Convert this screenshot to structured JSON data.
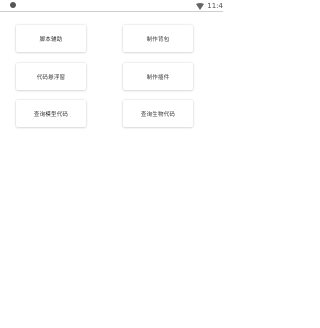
{
  "status_bar": {
    "time": "11:4",
    "left_icon": "status-dot-icon",
    "wifi_icon": "wifi-icon"
  },
  "tiles": [
    {
      "label": "脚本辅助"
    },
    {
      "label": "制作背包"
    },
    {
      "label": "代码悬浮窗"
    },
    {
      "label": "制作插件"
    },
    {
      "label": "查询模型代码"
    },
    {
      "label": "查询生物代码"
    }
  ]
}
